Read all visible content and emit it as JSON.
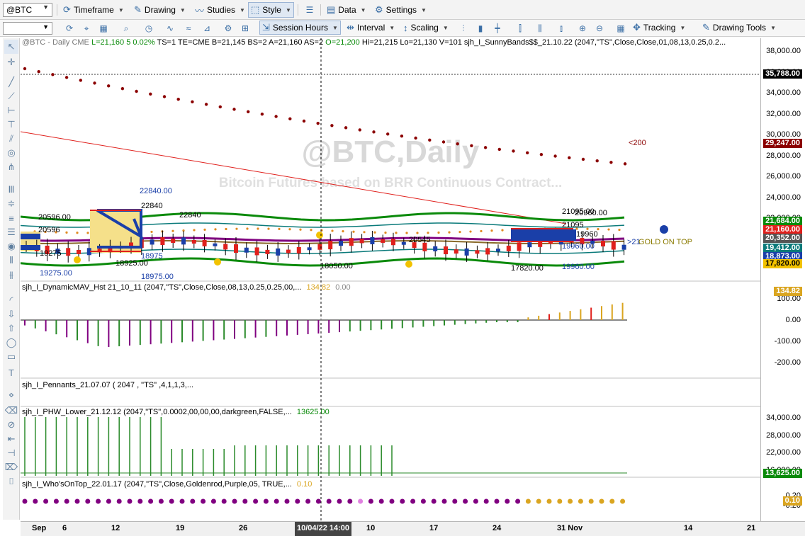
{
  "toolbar1": {
    "symbol": "@BTC",
    "timeframe": "Timeframe",
    "drawing": "Drawing",
    "studies": "Studies",
    "style": "Style",
    "data": "Data",
    "settings": "Settings"
  },
  "toolbar2": {
    "session_hours": "Session Hours",
    "interval": "Interval",
    "scaling": "Scaling",
    "tracking": "Tracking",
    "drawing_tools": "Drawing Tools"
  },
  "price_header": {
    "symbol_line": "@BTC - Daily  CME",
    "last": "L=21,160",
    "change": "5",
    "change_pct": "0.02%",
    "fields": "TS=1  TE=CME  B=21,145  BS=2  A=21,160  AS=2",
    "open": "O=21,200",
    "rest": "Hi=21,215  Lo=21,130  V=101  sjh_I_SunnyBands$$_21.10.22 (2047,\"TS\",Close,Close,01,08,13,0.25,0.2..."
  },
  "watermark": {
    "title": "@BTC,Daily",
    "subtitle": "Bitcoin Futures based on BRR Continuous Contract..."
  },
  "price_labels": {
    "l22840a": "22840.00",
    "l22840b": "22840",
    "l22840c": "22840",
    "l20596a": "20596.00",
    "l20596b": "20596",
    "l19275a": "19275",
    "l19275b": "19275.00",
    "l18975a": "18975",
    "l18975b": "18975.00",
    "l18925": "18925.00",
    "l18050": "18050.00",
    "l20545": "20545",
    "l17820": "17820.00",
    "l21095": "21095.00",
    "l20960": "20960.00",
    "l21095b": "21095",
    "l19960a": "19960.00",
    "l19960b": "19960",
    "l19960c": "19960.00",
    "gold_on_top": "GOLD ON TOP",
    "sma200": "<200",
    "arrow21": ">21"
  },
  "panels": {
    "dynamic_mav": {
      "name": "sjh_I_DynamicMAV_Hst 21_10_11 (2047,\"TS\",Close,Close,08,13,0.25,0.25,00,...",
      "v1": "134.82",
      "v2": "0.00"
    },
    "pennants": {
      "name": "sjh_I_Pennants_21.07.07 ( 2047 , \"TS\" ,4,1,1,3,..."
    },
    "phw_lower": {
      "name": "sjh_I_PHW_Lower_21.12.12 (2047,\"TS\",0.0002,00,00,00,darkgreen,FALSE,...",
      "v1": "13625.00"
    },
    "whos_on_top": {
      "name": "sjh_I_Who'sOnTop_22.01.17 (2047,\"TS\",Close,Goldenrod,Purple,05, TRUE,...",
      "v1": "0.10"
    }
  },
  "y_axis_main": [
    "38,000.00",
    "36,000.00",
    "34,000.00",
    "32,000.00",
    "30,000.00",
    "28,000.00",
    "26,000.00",
    "24,000.00",
    "22,000.00",
    "20,000.00",
    "18,000.00"
  ],
  "y_tags_main": [
    {
      "text": "35,788.00",
      "color": "#000000"
    },
    {
      "text": "29,247.00",
      "color": "#8b0000"
    },
    {
      "text": "21,684.00",
      "color": "#0a8a0a"
    },
    {
      "text": "21,160.00",
      "color": "#e0201c"
    },
    {
      "text": "20,352.00",
      "color": "#555555"
    },
    {
      "text": "19,412.00",
      "color": "#0a7a7a"
    },
    {
      "text": "18,873.00",
      "color": "#1a3fa8"
    },
    {
      "text": "17,820.00",
      "color": "#f2c200"
    }
  ],
  "y_axis_mav": [
    "100.00",
    "0.00",
    "-100.00",
    "-200.00"
  ],
  "y_tag_mav": "134.82",
  "y_axis_phw": [
    "34,000.00",
    "28,000.00",
    "22,000.00",
    "16,000.00"
  ],
  "y_tag_phw": "13,625.00",
  "y_axis_who": [
    "0.20",
    "-0.20"
  ],
  "y_tag_who": "0.10",
  "x_axis": {
    "sep": "Sep",
    "d6": "6",
    "d12": "12",
    "d19": "19",
    "d26": "26",
    "cursor": "10/04/22 14:00",
    "d10": "10",
    "d17": "17",
    "d24": "24",
    "d31": "31 Nov",
    "d14": "14",
    "d21": "21"
  },
  "colors": {
    "up": "#1a3fa8",
    "down": "#e0201c",
    "band_outer": "#0a8a0a",
    "band_inner": "#0a7a7a",
    "sma200": "#8b0000",
    "purple": "#800080",
    "gold": "#daa520"
  }
}
